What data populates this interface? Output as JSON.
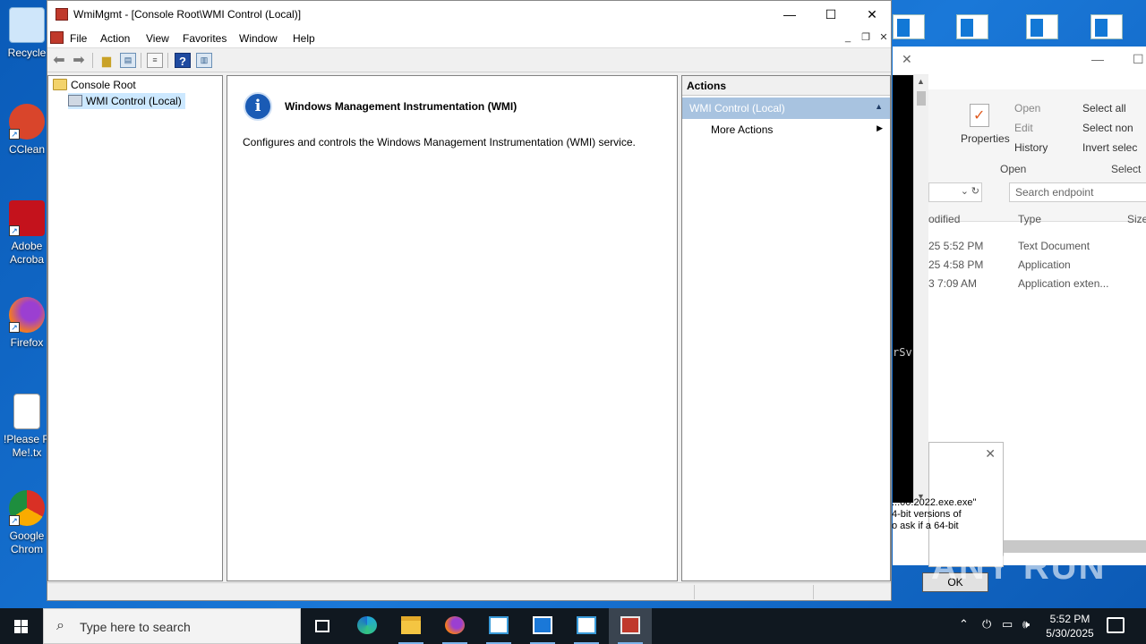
{
  "desktop": {
    "icons": [
      {
        "label": "Recycle",
        "color": "#5fa8e8"
      },
      {
        "label": "CClean",
        "color": "#d9452b"
      },
      {
        "label": "Adobe Acroba",
        "color": "#c4121c"
      },
      {
        "label": "Firefox",
        "color": "#f57b20"
      },
      {
        "label": "!Please R Me!.tx",
        "color": "#ffffff"
      },
      {
        "label": "Google Chrom",
        "color": "#2e9b49"
      }
    ]
  },
  "window": {
    "title": "WmiMgmt - [Console Root\\WMI Control (Local)]",
    "controls": {
      "minimize": "—",
      "maximize": "☐",
      "close": "✕"
    },
    "menu": [
      "File",
      "Action",
      "View",
      "Favorites",
      "Window",
      "Help"
    ],
    "mdi_controls": {
      "minimize": "_",
      "restore": "❐",
      "close": "✕"
    }
  },
  "tree": {
    "root": "Console Root",
    "child": "WMI Control (Local)"
  },
  "content": {
    "title": "Windows Management Instrumentation (WMI)",
    "description": "Configures and controls the Windows Management Instrumentation (WMI) service."
  },
  "actions": {
    "header": "Actions",
    "section": "WMI Control (Local)",
    "items": [
      "More Actions"
    ]
  },
  "explorer": {
    "ribbon": {
      "properties": "Properties",
      "open": "Open",
      "edit": "Edit",
      "history": "History",
      "select_all": "Select all",
      "select_none": "Select non",
      "invert": "Invert selec",
      "group_open": "Open",
      "group_select": "Select"
    },
    "search_placeholder": "Search endpoint",
    "columns": {
      "modified": "odified",
      "type": "Type",
      "size": "Size"
    },
    "rows": [
      {
        "modified": "25 5:52 PM",
        "type": "Text Document"
      },
      {
        "modified": "25 4:58 PM",
        "type": "Application"
      },
      {
        "modified": "3 7:09 AM",
        "type": "Application exten..."
      }
    ]
  },
  "console": {
    "fragment": "rSv"
  },
  "dialog": {
    "lines": [
      "...00.2022.exe.exe\"",
      "4-bit versions of",
      "o ask if a 64-bit"
    ],
    "ok": "OK"
  },
  "watermark": "ANY RUN",
  "taskbar": {
    "search_placeholder": "Type here to search",
    "time": "5:52 PM",
    "date": "5/30/2025"
  }
}
